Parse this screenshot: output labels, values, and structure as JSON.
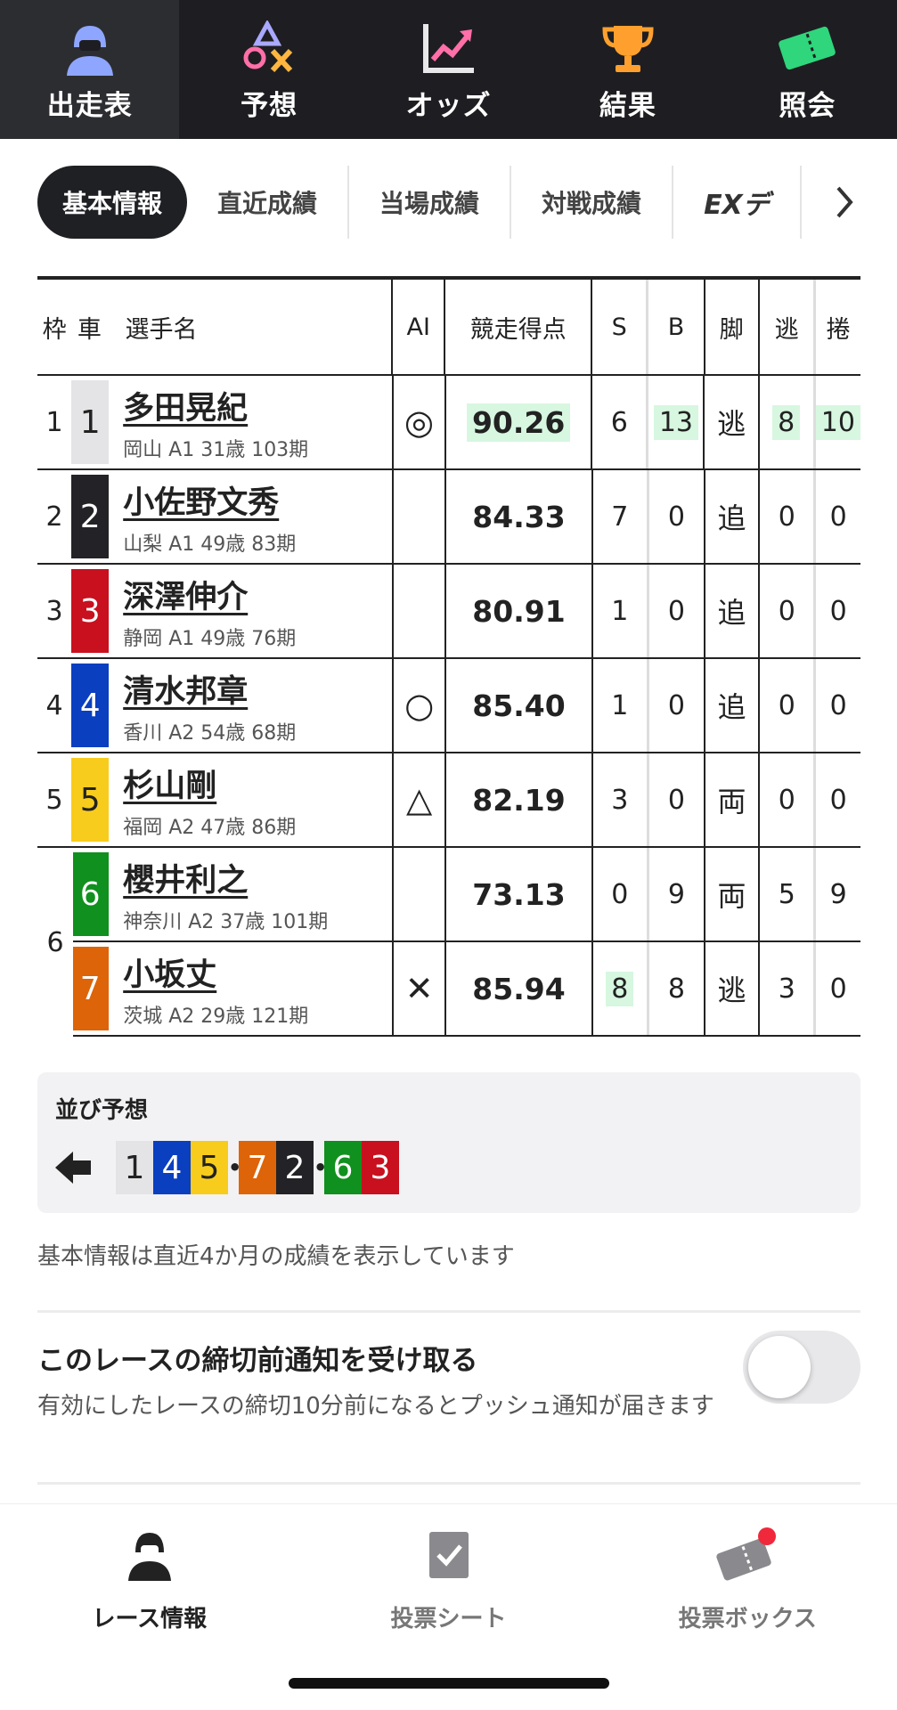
{
  "top_nav": {
    "tabs": [
      {
        "label": "出走表",
        "icon": "rider-icon",
        "active": true
      },
      {
        "label": "予想",
        "icon": "shapes-icon",
        "active": false
      },
      {
        "label": "オッズ",
        "icon": "trend-chart-icon",
        "active": false
      },
      {
        "label": "結果",
        "icon": "trophy-icon",
        "active": false
      },
      {
        "label": "照会",
        "icon": "ticket-icon",
        "active": false
      }
    ]
  },
  "sub_tabs": [
    {
      "label": "基本情報",
      "active": true
    },
    {
      "label": "直近成績"
    },
    {
      "label": "当場成績"
    },
    {
      "label": "対戦成績"
    },
    {
      "label": "EXデ"
    }
  ],
  "table": {
    "headers": {
      "waku": "枠",
      "car": "車",
      "name": "選手名",
      "ai": "AI",
      "score": "競走得点",
      "s": "S",
      "b": "B",
      "leg": "脚",
      "nige": "逃",
      "makuri": "捲"
    },
    "rows": [
      {
        "waku": "1",
        "car": "1",
        "name": "多田晃紀",
        "info": "岡山 A1 31歳 103期",
        "ai": "◎",
        "score": "90.26",
        "s": "6",
        "b": "13",
        "leg": "逃",
        "nige": "8",
        "makuri": "10",
        "car_bg": "#e4e4e7",
        "car_fg": "#222222"
      },
      {
        "waku": "2",
        "car": "2",
        "name": "小佐野文秀",
        "info": "山梨 A1 49歳 83期",
        "ai": "",
        "score": "84.33",
        "s": "7",
        "b": "0",
        "leg": "追",
        "nige": "0",
        "makuri": "0",
        "car_bg": "#232327",
        "car_fg": "#ffffff"
      },
      {
        "waku": "3",
        "car": "3",
        "name": "深澤伸介",
        "info": "静岡 A1 49歳 76期",
        "ai": "",
        "score": "80.91",
        "s": "1",
        "b": "0",
        "leg": "追",
        "nige": "0",
        "makuri": "0",
        "car_bg": "#c8101e",
        "car_fg": "#ffffff"
      },
      {
        "waku": "4",
        "car": "4",
        "name": "清水邦章",
        "info": "香川 A2 54歳 68期",
        "ai": "○",
        "score": "85.40",
        "s": "1",
        "b": "0",
        "leg": "追",
        "nige": "0",
        "makuri": "0",
        "car_bg": "#0a3fc0",
        "car_fg": "#ffffff"
      },
      {
        "waku": "5",
        "car": "5",
        "name": "杉山剛",
        "info": "福岡 A2 47歳 86期",
        "ai": "△",
        "score": "82.19",
        "s": "3",
        "b": "0",
        "leg": "両",
        "nige": "0",
        "makuri": "0",
        "car_bg": "#f8cc1c",
        "car_fg": "#222222"
      },
      {
        "waku": "6",
        "car": "6",
        "name": "櫻井利之",
        "info": "神奈川 A2 37歳 101期",
        "ai": "",
        "score": "73.13",
        "s": "0",
        "b": "9",
        "leg": "両",
        "nige": "5",
        "makuri": "9",
        "car_bg": "#10901e",
        "car_fg": "#ffffff"
      },
      {
        "waku": "6",
        "car": "7",
        "name": "小坂丈",
        "info": "茨城 A2 29歳 121期",
        "ai": "✕",
        "score": "85.94",
        "s": "8",
        "b": "8",
        "leg": "逃",
        "nige": "3",
        "makuri": "0",
        "car_bg": "#dd6408",
        "car_fg": "#ffffff"
      }
    ]
  },
  "lineup": {
    "title": "並び予想",
    "groups": [
      [
        {
          "n": "1",
          "bg": "#e4e4e7",
          "fg": "#222222"
        },
        {
          "n": "4",
          "bg": "#0a3fc0",
          "fg": "#ffffff"
        },
        {
          "n": "5",
          "bg": "#f8cc1c",
          "fg": "#222222"
        }
      ],
      [
        {
          "n": "7",
          "bg": "#dd6408",
          "fg": "#ffffff"
        },
        {
          "n": "2",
          "bg": "#232327",
          "fg": "#ffffff"
        }
      ],
      [
        {
          "n": "6",
          "bg": "#10901e",
          "fg": "#ffffff"
        },
        {
          "n": "3",
          "bg": "#c8101e",
          "fg": "#ffffff"
        }
      ]
    ]
  },
  "note": "基本情報は直近4か月の成績を表示しています",
  "notification": {
    "title": "このレースの締切前通知を受け取る",
    "description": "有効にしたレースの締切10分前になるとプッシュ通知が届きます",
    "enabled": false
  },
  "bottom_nav": {
    "items": [
      {
        "label": "レース情報",
        "icon": "rider-icon",
        "active": true
      },
      {
        "label": "投票シート",
        "icon": "check-sheet-icon",
        "active": false
      },
      {
        "label": "投票ボックス",
        "icon": "ticket-box-icon",
        "active": false,
        "badge": true
      }
    ]
  }
}
